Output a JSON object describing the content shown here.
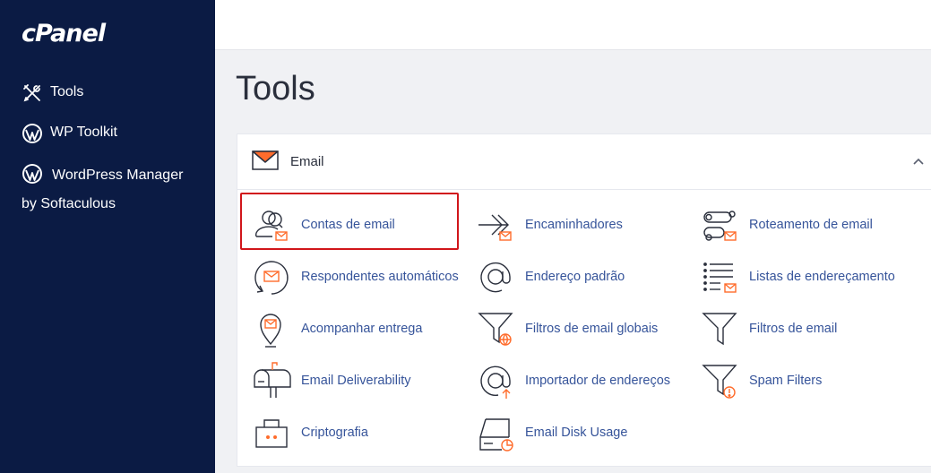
{
  "brand": {
    "logo_text": "cPanel"
  },
  "sidebar": {
    "items": [
      {
        "label": "Tools",
        "icon": "tools-icon"
      },
      {
        "label": "WP Toolkit",
        "icon": "wordpress-icon"
      },
      {
        "label": "WordPress Manager by Softaculous",
        "icon": "wordpress-icon"
      }
    ]
  },
  "page": {
    "title": "Tools"
  },
  "email_panel": {
    "title": "Email",
    "expanded": true,
    "tools": [
      {
        "label": "Contas de email",
        "icon": "email-accounts-icon",
        "highlighted": true
      },
      {
        "label": "Encaminhadores",
        "icon": "forwarders-icon"
      },
      {
        "label": "Roteamento de email",
        "icon": "email-routing-icon"
      },
      {
        "label": "Respondentes automáticos",
        "icon": "autoresponders-icon"
      },
      {
        "label": "Endereço padrão",
        "icon": "default-address-icon"
      },
      {
        "label": "Listas de endereçamento",
        "icon": "mailing-lists-icon"
      },
      {
        "label": "Acompanhar entrega",
        "icon": "track-delivery-icon"
      },
      {
        "label": "Filtros de email globais",
        "icon": "global-filters-icon"
      },
      {
        "label": "Filtros de email",
        "icon": "email-filters-icon"
      },
      {
        "label": "Email Deliverability",
        "icon": "mailbox-icon"
      },
      {
        "label": "Importador de endereços",
        "icon": "address-importer-icon"
      },
      {
        "label": "Spam Filters",
        "icon": "spam-filters-icon"
      },
      {
        "label": "Criptografia",
        "icon": "encryption-icon"
      },
      {
        "label": "Email Disk Usage",
        "icon": "disk-usage-icon"
      }
    ]
  },
  "colors": {
    "sidebar_bg": "#0b1b44",
    "accent": "#ff6c2c",
    "link": "#36549a",
    "highlight_border": "#d1161b"
  }
}
